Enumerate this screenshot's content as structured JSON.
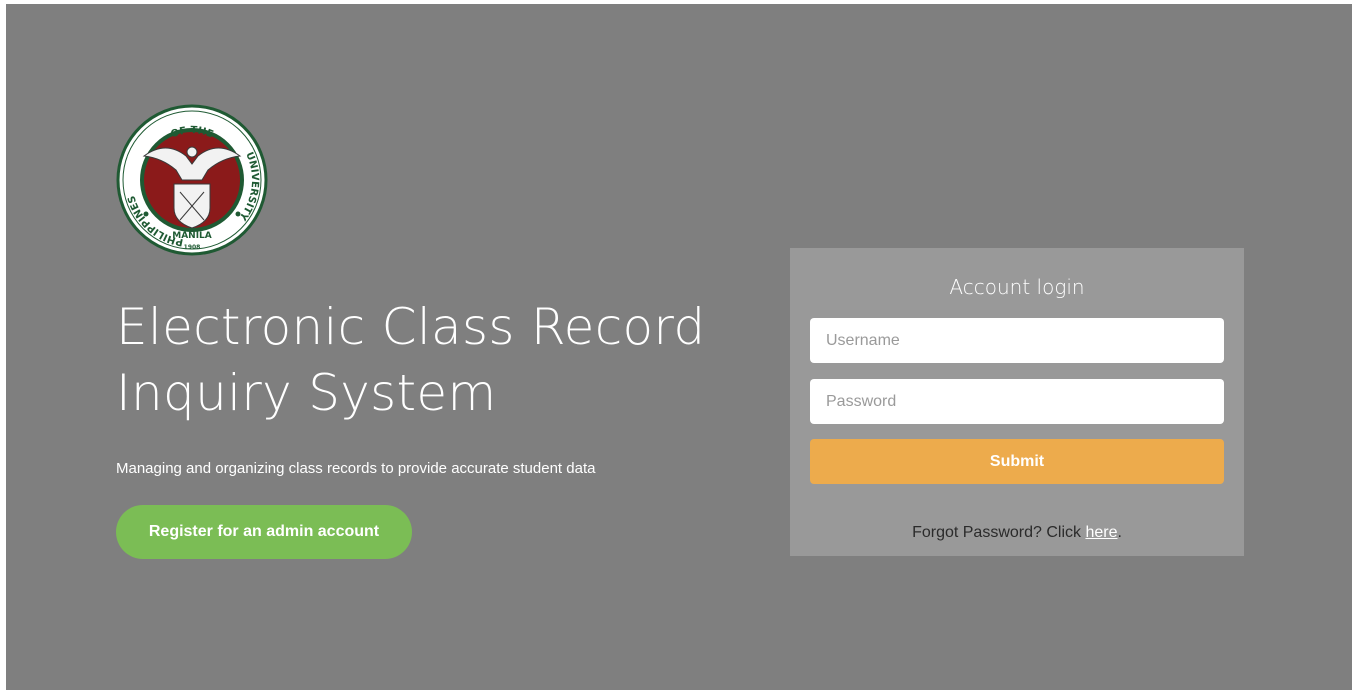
{
  "logo": {
    "name": "university-seal",
    "top_text": "OF THE",
    "left_text": "UNIVERSITY",
    "right_text": "PHILIPPINES",
    "bottom_text": "MANILA",
    "year": "1908",
    "colors": {
      "ring": "#1f5a33",
      "field": "#8b1a1a",
      "background": "#ffffff"
    }
  },
  "hero": {
    "title_line1": "Electronic Class Record",
    "title_line2": "Inquiry System",
    "subtitle": "Managing and organizing class records to provide accurate student data",
    "register_label": "Register for an admin account"
  },
  "login": {
    "title": "Account login",
    "username_placeholder": "Username",
    "username_value": "",
    "password_placeholder": "Password",
    "password_value": "",
    "submit_label": "Submit",
    "forgot_prefix": "Forgot Password? Click ",
    "forgot_link": "here",
    "forgot_suffix": "."
  },
  "colors": {
    "page_background": "#7f7f7f",
    "panel_background": "#999999",
    "register_button": "#7bbd55",
    "submit_button": "#edab4c"
  }
}
